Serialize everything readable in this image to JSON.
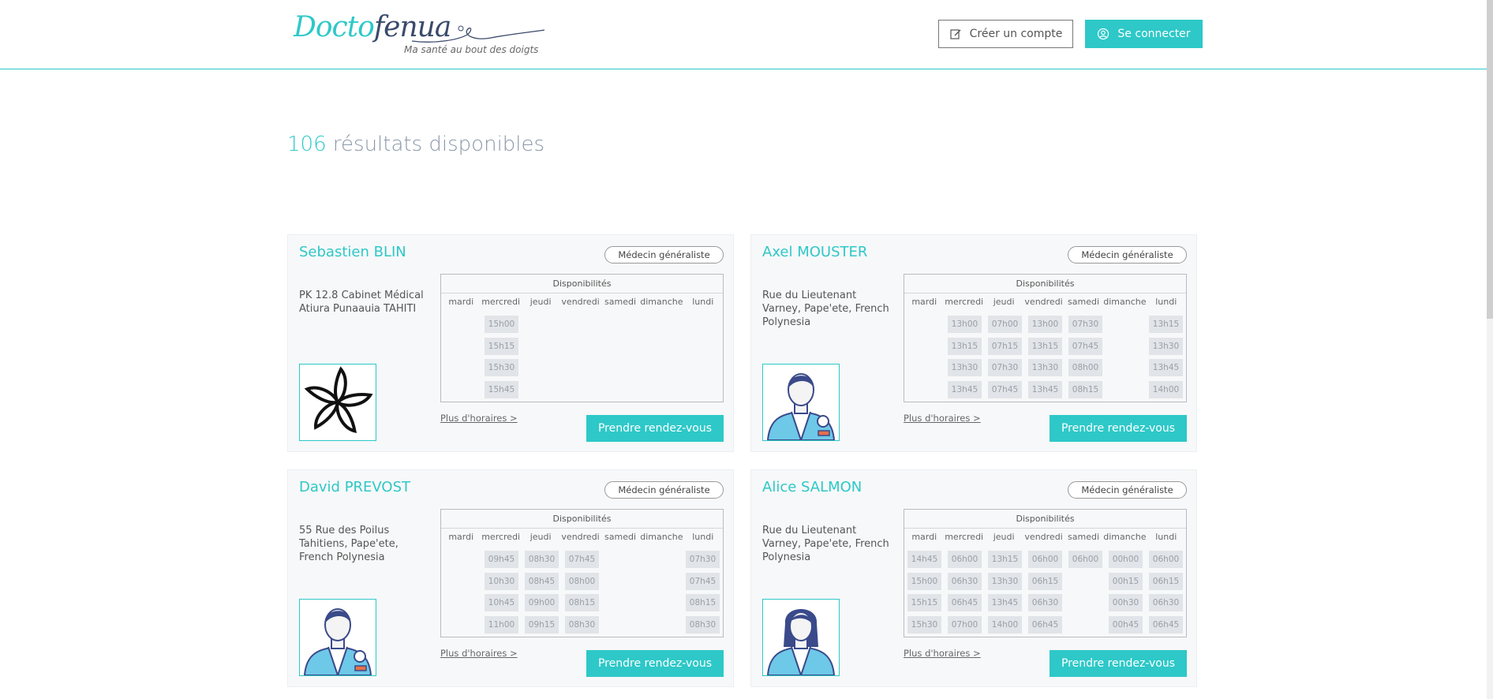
{
  "header": {
    "logo_part1": "Docto",
    "logo_part2": "fenua",
    "tagline": "Ma santé au bout des doigts",
    "create_account": "Créer un compte",
    "login": "Se connecter"
  },
  "results": {
    "count": "106",
    "label": "résultats disponibles"
  },
  "common": {
    "dispo_title": "Disponibilités",
    "more_hours": "Plus d'horaires >",
    "book": "Prendre rendez-vous",
    "days": [
      "mardi",
      "mercredi",
      "jeudi",
      "vendredi",
      "samedi",
      "dimanche",
      "lundi"
    ]
  },
  "doctors": [
    {
      "name": "Sebastien BLIN",
      "specialty": "Médecin généraliste",
      "address": "PK 12.8 Cabinet Médical Atiura Punaauia TAHITI",
      "avatar": "tiare-flower-icon",
      "slots": [
        [],
        [
          "15h00",
          "15h15",
          "15h30",
          "15h45"
        ],
        [],
        [],
        [],
        [],
        []
      ]
    },
    {
      "name": "Axel MOUSTER",
      "specialty": "Médecin généraliste",
      "address": "Rue du Lieutenant Varney, Pape'ete, French Polynesia",
      "avatar": "doctor-male-icon",
      "slots": [
        [],
        [
          "13h00",
          "13h15",
          "13h30",
          "13h45"
        ],
        [
          "07h00",
          "07h15",
          "07h30",
          "07h45"
        ],
        [
          "13h00",
          "13h15",
          "13h30",
          "13h45"
        ],
        [
          "07h30",
          "07h45",
          "08h00",
          "08h15"
        ],
        [],
        [
          "13h15",
          "13h30",
          "13h45",
          "14h00"
        ]
      ]
    },
    {
      "name": "David PREVOST",
      "specialty": "Médecin généraliste",
      "address": "55 Rue des Poilus Tahitiens, Pape'ete, French Polynesia",
      "avatar": "doctor-male-icon",
      "slots": [
        [],
        [
          "09h45",
          "10h30",
          "10h45",
          "11h00"
        ],
        [
          "08h30",
          "08h45",
          "09h00",
          "09h15"
        ],
        [
          "07h45",
          "08h00",
          "08h15",
          "08h30"
        ],
        [],
        [],
        [
          "07h30",
          "07h45",
          "08h15",
          "08h30"
        ]
      ]
    },
    {
      "name": "Alice SALMON",
      "specialty": "Médecin généraliste",
      "address": "Rue du Lieutenant Varney, Pape'ete, French Polynesia",
      "avatar": "doctor-female-icon",
      "slots": [
        [
          "14h45",
          "15h00",
          "15h15",
          "15h30"
        ],
        [
          "06h00",
          "06h30",
          "06h45",
          "07h00"
        ],
        [
          "13h15",
          "13h30",
          "13h45",
          "14h00"
        ],
        [
          "06h00",
          "06h15",
          "06h30",
          "06h45"
        ],
        [
          "06h00"
        ],
        [
          "00h00",
          "00h15",
          "00h30",
          "00h45"
        ],
        [
          "06h00",
          "06h15",
          "06h30",
          "06h45"
        ]
      ]
    }
  ],
  "colors": {
    "accent": "#2ec8c8",
    "slot_bg": "#e1e4e8",
    "heading_grey": "#8a98a8"
  }
}
